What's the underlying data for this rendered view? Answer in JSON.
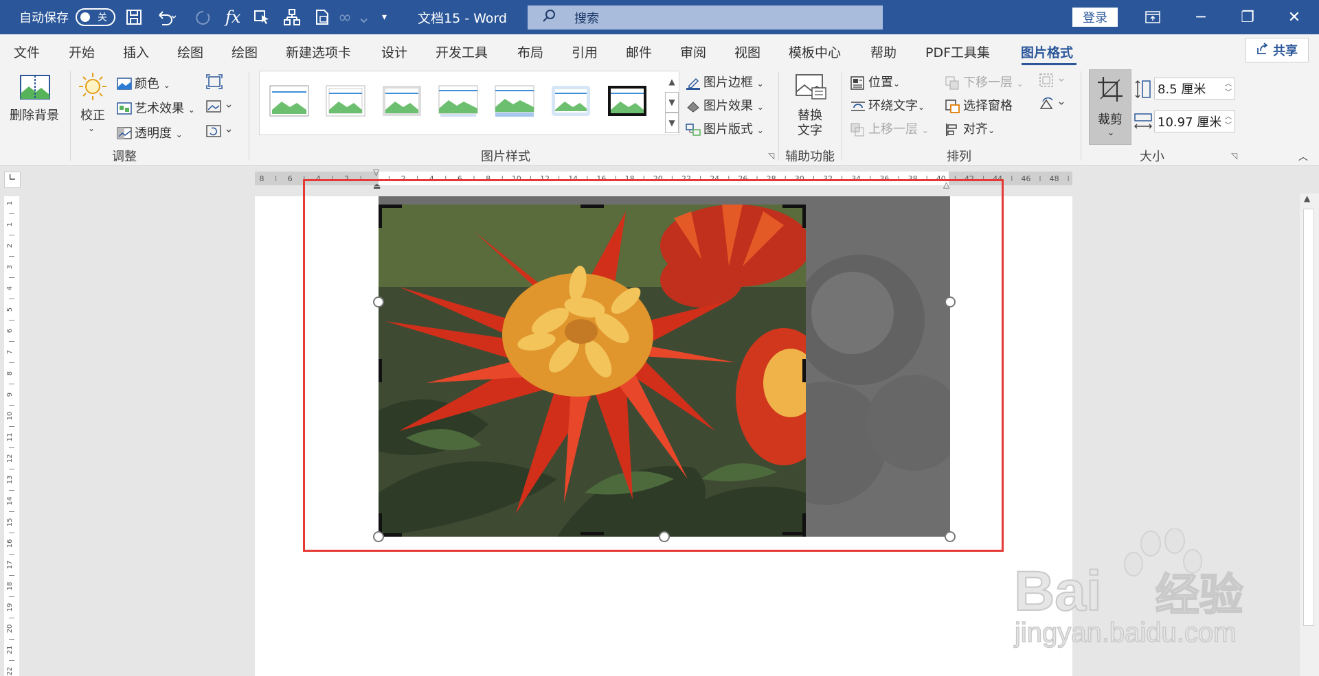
{
  "titlebar": {
    "autosave_label": "自动保存",
    "autosave_state": "关",
    "doc_title": "文档15  -  Word",
    "search_placeholder": "搜索",
    "login_label": "登录"
  },
  "tabs": [
    "文件",
    "开始",
    "插入",
    "绘图",
    "绘图",
    "新建选项卡",
    "设计",
    "开发工具",
    "布局",
    "引用",
    "邮件",
    "审阅",
    "视图",
    "模板中心",
    "帮助",
    "PDF工具集",
    "图片格式"
  ],
  "active_tab": "图片格式",
  "share_label": "共享",
  "ribbon": {
    "remove_bg": "删除背景",
    "correct": "校正",
    "color": "颜色",
    "art_effect": "艺术效果",
    "transparency": "透明度",
    "group_adjust": "调整",
    "group_styles": "图片样式",
    "picture_border": "图片边框",
    "picture_effect": "图片效果",
    "picture_layout": "图片版式",
    "alt_text_1": "替换",
    "alt_text_2": "文字",
    "group_access": "辅助功能",
    "position": "位置",
    "wrap_text": "环绕文字",
    "bring_forward": "上移一层",
    "send_backward": "下移一层",
    "selection_pane": "选择窗格",
    "align": "对齐",
    "group_arrange": "排列",
    "crop": "裁剪",
    "height_value": "8.5 厘米",
    "width_value": "10.97 厘米",
    "group_size": "大小"
  },
  "ruler": {
    "h_labels": [
      "8",
      "6",
      "4",
      "2",
      "",
      "2",
      "4",
      "6",
      "8",
      "10",
      "12",
      "14",
      "16",
      "18",
      "20",
      "22",
      "24",
      "26",
      "28",
      "30",
      "32",
      "34",
      "36",
      "38",
      "40",
      "42",
      "44",
      "46",
      "48"
    ],
    "v_labels": [
      "1",
      "1",
      "2",
      "3",
      "4",
      "5",
      "6",
      "7",
      "8",
      "9",
      "10",
      "11",
      "12",
      "13",
      "14",
      "15",
      "16",
      "17",
      "18",
      "19",
      "20",
      "21",
      "22"
    ]
  },
  "watermark": {
    "line1": "Bai",
    "line1b": "经验",
    "line2": "jingyan.baidu.com"
  }
}
